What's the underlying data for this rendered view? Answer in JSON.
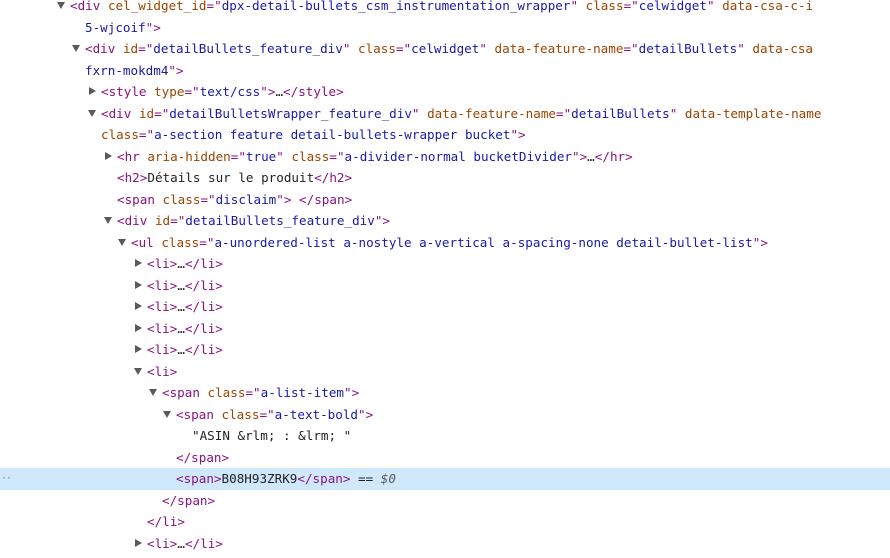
{
  "rows": [
    {
      "indent": 70,
      "arrow": "down",
      "parts": [
        [
          "punct",
          "<"
        ],
        [
          "tag",
          "div "
        ],
        [
          "attr",
          "cel_widget_id"
        ],
        [
          "eq",
          "=\""
        ],
        [
          "val",
          "dpx-detail-bullets_csm_instrumentation_wrapper"
        ],
        [
          "eq",
          "\" "
        ],
        [
          "attr",
          "class"
        ],
        [
          "eq",
          "=\""
        ],
        [
          "val",
          "celwidget"
        ],
        [
          "eq",
          "\" "
        ],
        [
          "attr",
          "data-csa-c-i"
        ]
      ]
    },
    {
      "indent": 85,
      "arrow": null,
      "parts": [
        [
          "val",
          "5-wjcoif"
        ],
        [
          "eq",
          "\">"
        ]
      ]
    },
    {
      "indent": 85,
      "arrow": "down",
      "parts": [
        [
          "punct",
          "<"
        ],
        [
          "tag",
          "div "
        ],
        [
          "attr",
          "id"
        ],
        [
          "eq",
          "=\""
        ],
        [
          "val",
          "detailBullets_feature_div"
        ],
        [
          "eq",
          "\" "
        ],
        [
          "attr",
          "class"
        ],
        [
          "eq",
          "=\""
        ],
        [
          "val",
          "celwidget"
        ],
        [
          "eq",
          "\" "
        ],
        [
          "attr",
          "data-feature-name"
        ],
        [
          "eq",
          "=\""
        ],
        [
          "val",
          "detailBullets"
        ],
        [
          "eq",
          "\" "
        ],
        [
          "attr",
          "data-csa"
        ]
      ]
    },
    {
      "indent": 85,
      "arrow": null,
      "parts": [
        [
          "val",
          "fxrn-mokdm4"
        ],
        [
          "eq",
          "\">"
        ]
      ]
    },
    {
      "indent": 101,
      "arrow": "right",
      "parts": [
        [
          "punct",
          "<"
        ],
        [
          "tag",
          "style "
        ],
        [
          "attr",
          "type"
        ],
        [
          "eq",
          "=\""
        ],
        [
          "val",
          "text/css"
        ],
        [
          "eq",
          "\">"
        ],
        [
          "ellipsis",
          "…"
        ],
        [
          "punct",
          "</"
        ],
        [
          "tag",
          "style"
        ],
        [
          "punct",
          ">"
        ]
      ]
    },
    {
      "indent": 101,
      "arrow": "down",
      "parts": [
        [
          "punct",
          "<"
        ],
        [
          "tag",
          "div "
        ],
        [
          "attr",
          "id"
        ],
        [
          "eq",
          "=\""
        ],
        [
          "val",
          "detailBulletsWrapper_feature_div"
        ],
        [
          "eq",
          "\" "
        ],
        [
          "attr",
          "data-feature-name"
        ],
        [
          "eq",
          "=\""
        ],
        [
          "val",
          "detailBullets"
        ],
        [
          "eq",
          "\" "
        ],
        [
          "attr",
          "data-template-name"
        ]
      ]
    },
    {
      "indent": 101,
      "arrow": null,
      "parts": [
        [
          "attr",
          "class"
        ],
        [
          "eq",
          "=\""
        ],
        [
          "val",
          "a-section feature detail-bullets-wrapper bucket"
        ],
        [
          "eq",
          "\">"
        ]
      ]
    },
    {
      "indent": 117,
      "arrow": "right",
      "parts": [
        [
          "punct",
          "<"
        ],
        [
          "tag",
          "hr "
        ],
        [
          "attr",
          "aria-hidden"
        ],
        [
          "eq",
          "=\""
        ],
        [
          "val",
          "true"
        ],
        [
          "eq",
          "\" "
        ],
        [
          "attr",
          "class"
        ],
        [
          "eq",
          "=\""
        ],
        [
          "val",
          "a-divider-normal bucketDivider"
        ],
        [
          "eq",
          "\">"
        ],
        [
          "ellipsis",
          "…"
        ],
        [
          "punct",
          "</"
        ],
        [
          "tag",
          "hr"
        ],
        [
          "punct",
          ">"
        ]
      ]
    },
    {
      "indent": 117,
      "arrow": null,
      "parts": [
        [
          "punct",
          "<"
        ],
        [
          "tag",
          "h2"
        ],
        [
          "punct",
          ">"
        ],
        [
          "text",
          "Détails sur le produit"
        ],
        [
          "punct",
          "</"
        ],
        [
          "tag",
          "h2"
        ],
        [
          "punct",
          ">"
        ]
      ]
    },
    {
      "indent": 117,
      "arrow": null,
      "parts": [
        [
          "punct",
          "<"
        ],
        [
          "tag",
          "span "
        ],
        [
          "attr",
          "class"
        ],
        [
          "eq",
          "=\""
        ],
        [
          "val",
          "disclaim"
        ],
        [
          "eq",
          "\">"
        ],
        [
          "text",
          " "
        ],
        [
          "punct",
          "</"
        ],
        [
          "tag",
          "span"
        ],
        [
          "punct",
          ">"
        ]
      ]
    },
    {
      "indent": 117,
      "arrow": "down",
      "parts": [
        [
          "punct",
          "<"
        ],
        [
          "tag",
          "div "
        ],
        [
          "attr",
          "id"
        ],
        [
          "eq",
          "=\""
        ],
        [
          "val",
          "detailBullets_feature_div"
        ],
        [
          "eq",
          "\">"
        ]
      ]
    },
    {
      "indent": 131,
      "arrow": "down",
      "parts": [
        [
          "punct",
          "<"
        ],
        [
          "tag",
          "ul "
        ],
        [
          "attr",
          "class"
        ],
        [
          "eq",
          "=\""
        ],
        [
          "val",
          "a-unordered-list a-nostyle a-vertical a-spacing-none detail-bullet-list"
        ],
        [
          "eq",
          "\">"
        ]
      ]
    },
    {
      "indent": 147,
      "arrow": "right",
      "parts": [
        [
          "punct",
          "<"
        ],
        [
          "tag",
          "li"
        ],
        [
          "punct",
          ">"
        ],
        [
          "ellipsis",
          "…"
        ],
        [
          "punct",
          "</"
        ],
        [
          "tag",
          "li"
        ],
        [
          "punct",
          ">"
        ]
      ]
    },
    {
      "indent": 147,
      "arrow": "right",
      "parts": [
        [
          "punct",
          "<"
        ],
        [
          "tag",
          "li"
        ],
        [
          "punct",
          ">"
        ],
        [
          "ellipsis",
          "…"
        ],
        [
          "punct",
          "</"
        ],
        [
          "tag",
          "li"
        ],
        [
          "punct",
          ">"
        ]
      ]
    },
    {
      "indent": 147,
      "arrow": "right",
      "parts": [
        [
          "punct",
          "<"
        ],
        [
          "tag",
          "li"
        ],
        [
          "punct",
          ">"
        ],
        [
          "ellipsis",
          "…"
        ],
        [
          "punct",
          "</"
        ],
        [
          "tag",
          "li"
        ],
        [
          "punct",
          ">"
        ]
      ]
    },
    {
      "indent": 147,
      "arrow": "right",
      "parts": [
        [
          "punct",
          "<"
        ],
        [
          "tag",
          "li"
        ],
        [
          "punct",
          ">"
        ],
        [
          "ellipsis",
          "…"
        ],
        [
          "punct",
          "</"
        ],
        [
          "tag",
          "li"
        ],
        [
          "punct",
          ">"
        ]
      ]
    },
    {
      "indent": 147,
      "arrow": "right",
      "parts": [
        [
          "punct",
          "<"
        ],
        [
          "tag",
          "li"
        ],
        [
          "punct",
          ">"
        ],
        [
          "ellipsis",
          "…"
        ],
        [
          "punct",
          "</"
        ],
        [
          "tag",
          "li"
        ],
        [
          "punct",
          ">"
        ]
      ]
    },
    {
      "indent": 147,
      "arrow": "down",
      "parts": [
        [
          "punct",
          "<"
        ],
        [
          "tag",
          "li"
        ],
        [
          "punct",
          ">"
        ]
      ]
    },
    {
      "indent": 162,
      "arrow": "down",
      "parts": [
        [
          "punct",
          "<"
        ],
        [
          "tag",
          "span "
        ],
        [
          "attr",
          "class"
        ],
        [
          "eq",
          "=\""
        ],
        [
          "val",
          "a-list-item"
        ],
        [
          "eq",
          "\">"
        ]
      ]
    },
    {
      "indent": 176,
      "arrow": "down",
      "parts": [
        [
          "punct",
          "<"
        ],
        [
          "tag",
          "span "
        ],
        [
          "attr",
          "class"
        ],
        [
          "eq",
          "=\""
        ],
        [
          "val",
          "a-text-bold"
        ],
        [
          "eq",
          "\">"
        ]
      ]
    },
    {
      "indent": 192,
      "arrow": null,
      "parts": [
        [
          "text",
          "\"ASIN &rlm; : &lrm; \""
        ]
      ]
    },
    {
      "indent": 176,
      "arrow": null,
      "parts": [
        [
          "punct",
          "</"
        ],
        [
          "tag",
          "span"
        ],
        [
          "punct",
          ">"
        ]
      ]
    },
    {
      "indent": 176,
      "arrow": null,
      "selected": true,
      "parts": [
        [
          "punct",
          "<"
        ],
        [
          "tag",
          "span"
        ],
        [
          "punct",
          ">"
        ],
        [
          "text",
          "B08H93ZRK9"
        ],
        [
          "punct",
          "</"
        ],
        [
          "tag",
          "span"
        ],
        [
          "punct",
          "> "
        ],
        [
          "text",
          "== "
        ],
        [
          "dollar",
          "$0"
        ]
      ]
    },
    {
      "indent": 162,
      "arrow": null,
      "parts": [
        [
          "punct",
          "</"
        ],
        [
          "tag",
          "span"
        ],
        [
          "punct",
          ">"
        ]
      ]
    },
    {
      "indent": 147,
      "arrow": null,
      "parts": [
        [
          "punct",
          "</"
        ],
        [
          "tag",
          "li"
        ],
        [
          "punct",
          ">"
        ]
      ]
    },
    {
      "indent": 147,
      "arrow": "right",
      "parts": [
        [
          "punct",
          "<"
        ],
        [
          "tag",
          "li"
        ],
        [
          "punct",
          ">"
        ],
        [
          "ellipsis",
          "…"
        ],
        [
          "punct",
          "</"
        ],
        [
          "tag",
          "li"
        ],
        [
          "punct",
          ">"
        ]
      ]
    }
  ],
  "gutter_marker": "··"
}
